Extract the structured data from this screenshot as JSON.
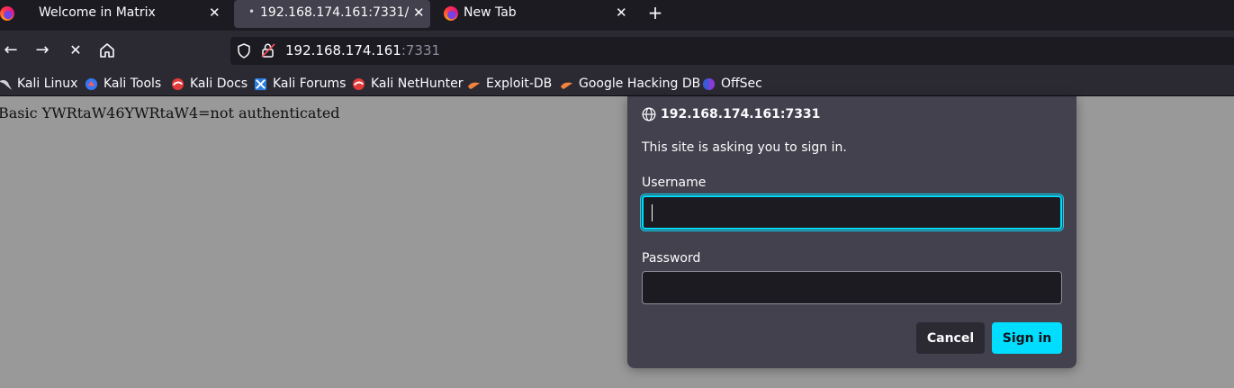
{
  "tabs": [
    {
      "title": "Welcome in Matrix",
      "icon": "firefox-icon"
    },
    {
      "title": "192.168.174.161:7331/",
      "icon": "loading-dot"
    },
    {
      "title": "New Tab",
      "icon": "firefox-icon"
    }
  ],
  "new_tab_glyph": "+",
  "nav": {
    "back_glyph": "←",
    "forward_glyph": "→",
    "stop_glyph": "✕",
    "home_glyph": "⌂"
  },
  "url": {
    "host": "192.168.174.161",
    "port": ":7331"
  },
  "bookmarks": [
    {
      "label": "Kali Linux",
      "icon": "kali-dragon-icon"
    },
    {
      "label": "Kali Tools",
      "icon": "kali-tools-icon"
    },
    {
      "label": "Kali Docs",
      "icon": "kali-docs-icon"
    },
    {
      "label": "Kali Forums",
      "icon": "kali-forums-icon"
    },
    {
      "label": "Kali NetHunter",
      "icon": "kali-nethunter-icon"
    },
    {
      "label": "Exploit-DB",
      "icon": "exploit-db-icon"
    },
    {
      "label": "Google Hacking DB",
      "icon": "ghdb-icon"
    },
    {
      "label": "OffSec",
      "icon": "offsec-icon"
    }
  ],
  "page": {
    "text": "Basic YWRtaW46YWRtaW4=not authenticated"
  },
  "dialog": {
    "host": "192.168.174.161:7331",
    "message": "This site is asking you to sign in.",
    "username_label": "Username",
    "username_value": "",
    "password_label": "Password",
    "password_value": "",
    "cancel_label": "Cancel",
    "signin_label": "Sign in"
  },
  "colors": {
    "accent": "#00ddff",
    "chrome_dark": "#1c1b22",
    "chrome": "#2b2a33",
    "dialog_bg": "#42414d",
    "page_bg": "#999999"
  }
}
